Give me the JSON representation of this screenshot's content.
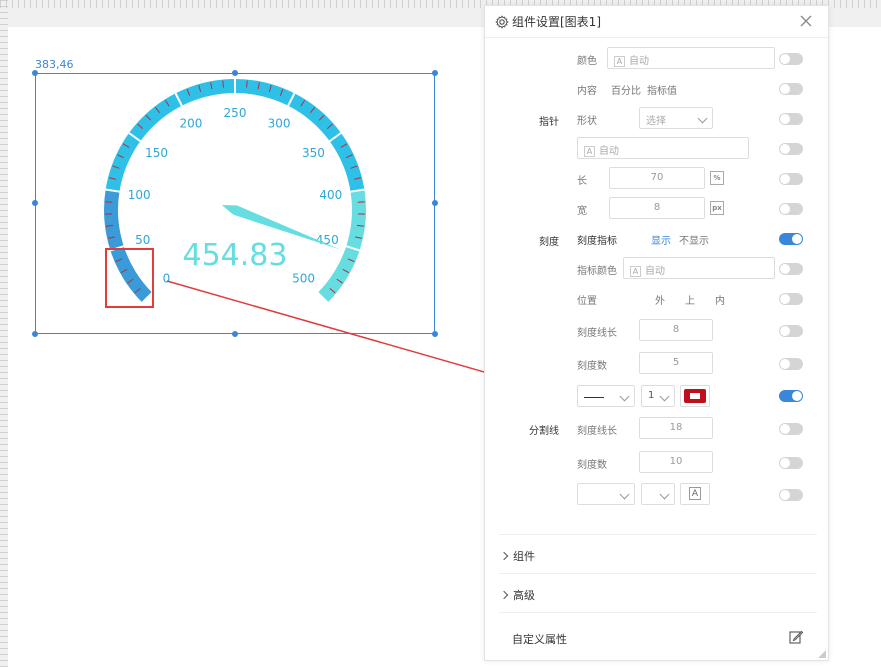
{
  "canvas": {
    "coord_label": "383,46"
  },
  "gauge": {
    "value_text": "454.83",
    "value": 454.83,
    "min": 0,
    "max": 500,
    "tick_labels": [
      "0",
      "50",
      "100",
      "150",
      "200",
      "250",
      "300",
      "350",
      "400",
      "450",
      "500"
    ],
    "colors": {
      "low": "#3a9bd8",
      "mid": "#2fc0e8",
      "high": "#66dde0",
      "needle": "#66dde0",
      "value": "#66dde0",
      "tick": "#b03040",
      "label": "#2fa7d8"
    }
  },
  "panel": {
    "title": "组件设置[图表1]",
    "rows": {
      "color_label": "颜色",
      "color_value": "自动",
      "content_label": "内容",
      "content_opt1": "百分比",
      "content_opt2": "指标值",
      "pointer_group": "指针",
      "shape_label": "形状",
      "shape_value": "选择",
      "pointer_color_value": "自动",
      "length_label": "长",
      "length_value": "70",
      "length_unit": "%",
      "width_label": "宽",
      "width_value": "8",
      "width_unit": "px",
      "scale_group": "刻度",
      "scale_indicator_label": "刻度指标",
      "show_opt": "显示",
      "hide_opt": "不显示",
      "indicator_color_label": "指标颜色",
      "indicator_color_value": "自动",
      "position_label": "位置",
      "pos_out": "外",
      "pos_top": "上",
      "pos_in": "内",
      "scale_line_len_label": "刻度线长",
      "scale_line_len_value": "8",
      "scale_count_label": "刻度数",
      "scale_count_value": "5",
      "line_width_value": "1",
      "divider_group": "分割线",
      "div_line_len_label": "刻度线长",
      "div_line_len_value": "18",
      "div_count_label": "刻度数",
      "div_count_value": "10",
      "swatch_color": "#c0101c",
      "font_icon_text": "A"
    },
    "sections": [
      "组件",
      "高级"
    ],
    "custom_attr": "自定义属性"
  }
}
